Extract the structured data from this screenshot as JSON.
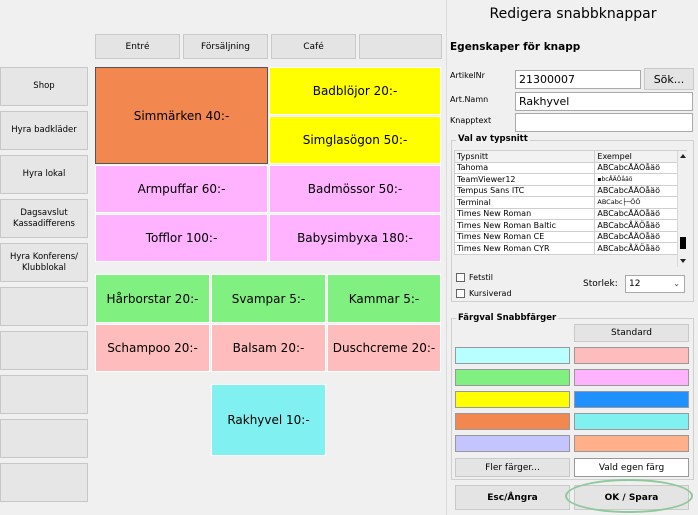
{
  "tabs": [
    "Entré",
    "Försäljning",
    "Café",
    ""
  ],
  "sidebar": [
    "Shop",
    "Hyra badkläder",
    "Hyra lokal",
    "Dagsavslut Kassadifferens",
    "Hyra Konferens/ Klubblokal",
    "",
    "",
    "",
    "",
    ""
  ],
  "tiles": [
    {
      "label": "Simmärken 40:-",
      "color": "#f2884f"
    },
    {
      "label": "Badblöjor 20:-",
      "color": "#ffff00"
    },
    {
      "label": "Simglasögon 50:-",
      "color": "#ffff00"
    },
    {
      "label": "Armpuffar 60:-",
      "color": "#ffb3ff"
    },
    {
      "label": "Badmössor 50:-",
      "color": "#ffb3ff"
    },
    {
      "label": "Tofflor 100:-",
      "color": "#ffb3ff"
    },
    {
      "label": "Babysimbyxa 180:-",
      "color": "#ffb3ff"
    },
    {
      "label": "Hårborstar 20:-",
      "color": "#80f080"
    },
    {
      "label": "Svampar 5:-",
      "color": "#80f080"
    },
    {
      "label": "Kammar 5:-",
      "color": "#80f080"
    },
    {
      "label": "Schampoo 20:-",
      "color": "#ffbcbc"
    },
    {
      "label": "Balsam 20:-",
      "color": "#ffbcbc"
    },
    {
      "label": "Duschcreme 20:-",
      "color": "#ffbcbc"
    },
    {
      "label": "Rakhyvel 10:-",
      "color": "#80f0f0"
    }
  ],
  "panel": {
    "title": "Redigera snabbknappar",
    "section_title": "Egenskaper för knapp",
    "artikelnr_label": "ArtikelNr",
    "artikelnr_value": "21300007",
    "search_button": "Sök...",
    "artnamn_label": "Art.Namn",
    "artnamn_value": "Rakhyvel",
    "knapptext_label": "Knapptext",
    "knapptext_value": "",
    "font_group_title": "Val av typsnitt",
    "font_col1": "Typsnitt",
    "font_col2": "Exempel",
    "fonts": [
      {
        "name": "Tahoma",
        "sample": "ABCabcÅÄÖåäö"
      },
      {
        "name": "TeamViewer12",
        "sample": "▪bcÅÄÖåäö"
      },
      {
        "name": "Tempus Sans ITC",
        "sample": "ABCabcÅÄÖåäö"
      },
      {
        "name": "Terminal",
        "sample": "ABCabc├─ÖÖ"
      },
      {
        "name": "Times New Roman",
        "sample": "ABCabcÅÄÖåäö"
      },
      {
        "name": "Times New Roman Baltic",
        "sample": "ABCabcÅÄÖåäö"
      },
      {
        "name": "Times New Roman CE",
        "sample": "ABCabcÅÄÖåäö"
      },
      {
        "name": "Times New Roman CYR",
        "sample": "ABCabcÅÄÖåäö"
      }
    ],
    "fetstil_label": "Fetstil",
    "kursiverad_label": "Kursiverad",
    "storlek_label": "Storlek:",
    "storlek_value": "12",
    "color_group_title": "Färgval Snabbfärger",
    "standard_button": "Standard",
    "swatches_left": [
      "#b8ffff",
      "#80f080",
      "#ffff00",
      "#f2884f",
      "#c4c4ff"
    ],
    "swatches_right": [
      "#ffbcbc",
      "#ffb3ff",
      "#1e90ff",
      "#80f0f0",
      "#ffb08a"
    ],
    "more_colors_button": "Fler färger...",
    "own_color_label": "Vald egen färg",
    "cancel_button": "Esc/Ångra",
    "ok_button": "OK / Spara"
  }
}
